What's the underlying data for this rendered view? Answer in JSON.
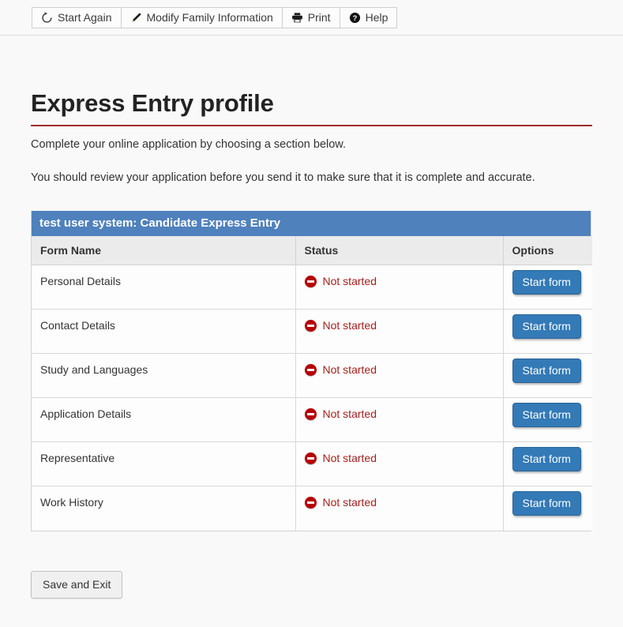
{
  "toolbar": {
    "buttons": [
      {
        "label": "Start Again",
        "icon": "restart-icon"
      },
      {
        "label": "Modify Family Information",
        "icon": "pencil-icon"
      },
      {
        "label": "Print",
        "icon": "printer-icon"
      },
      {
        "label": "Help",
        "icon": "help-circle-icon"
      }
    ]
  },
  "page": {
    "title": "Express Entry profile",
    "intro_1": "Complete your online application by choosing a section below.",
    "intro_2": "You should review your application before you send it to make sure that it is complete and accurate."
  },
  "table": {
    "caption": "test user system: Candidate Express Entry",
    "columns": [
      "Form Name",
      "Status",
      "Options"
    ],
    "rows": [
      {
        "name": "Personal Details",
        "status": "Not started",
        "status_icon": "not-started-icon",
        "action": "Start form"
      },
      {
        "name": "Contact Details",
        "status": "Not started",
        "status_icon": "not-started-icon",
        "action": "Start form"
      },
      {
        "name": "Study and Languages",
        "status": "Not started",
        "status_icon": "not-started-icon",
        "action": "Start form"
      },
      {
        "name": "Application Details",
        "status": "Not started",
        "status_icon": "not-started-icon",
        "action": "Start form"
      },
      {
        "name": "Representative",
        "status": "Not started",
        "status_icon": "not-started-icon",
        "action": "Start form"
      },
      {
        "name": "Work History",
        "status": "Not started",
        "status_icon": "not-started-icon",
        "action": "Start form"
      }
    ]
  },
  "footer": {
    "save_label": "Save and Exit"
  },
  "colors": {
    "caption_bar": "#4f81bd",
    "rule": "#a02c2c",
    "status_red": "#b50000",
    "primary_button": "#337ab7",
    "page_background": "#f9f9f9"
  }
}
